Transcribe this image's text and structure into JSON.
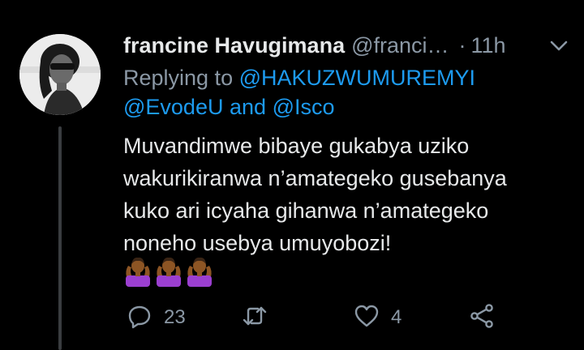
{
  "tweet": {
    "display_name": "francine Havugimana",
    "handle": "@franci…",
    "separator": "·",
    "time": "11h",
    "replying_to_prefix": "Replying to",
    "mentions": [
      "@HAKUZWUMUREMYI",
      "@EvodeU",
      "@Isco"
    ],
    "mention_joiner": "and",
    "body_lines": [
      "Muvandimwe bibaye gukabya uziko",
      "wakurikiranwa n’amategeko gusebanya",
      "kuko ari icyaha gihanwa n’amategeko",
      "noneho usebya umuyobozi!"
    ],
    "emojis": [
      "person-shrugging-emoji",
      "person-shrugging-emoji",
      "person-shrugging-emoji"
    ],
    "actions": {
      "reply_count": "23",
      "retweet_count": "",
      "like_count": "4"
    }
  },
  "colors": {
    "background": "#000000",
    "text_primary": "#e7e9ea",
    "text_secondary": "#8b98a5",
    "link": "#1d9bf0",
    "emoji_shirt": "#9b3fd0",
    "emoji_skin": "#8d5524"
  },
  "icons": [
    "more-chevron-icon",
    "reply-icon",
    "retweet-icon",
    "like-icon",
    "share-icon"
  ]
}
